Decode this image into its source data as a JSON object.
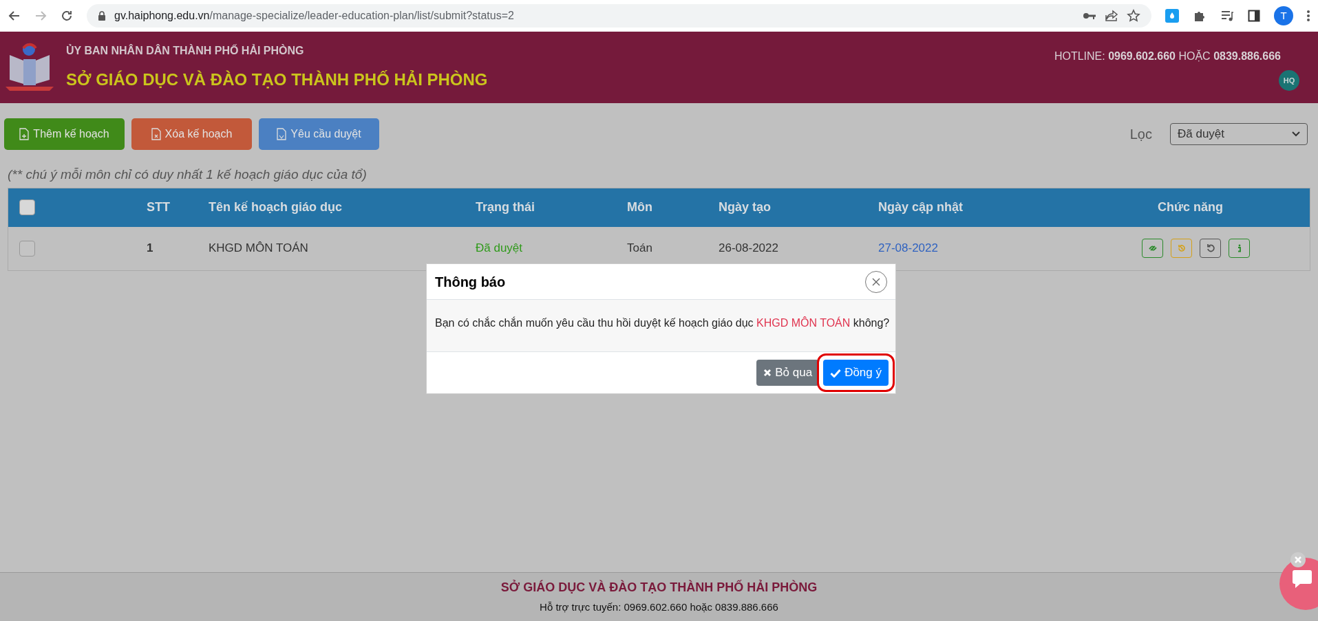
{
  "browser": {
    "url_domain": "gv.haiphong.edu.vn",
    "url_path": "/manage-specialize/leader-education-plan/list/submit?status=2",
    "profile_initial": "T"
  },
  "header": {
    "org": "ỦY BAN NHÂN DÂN THÀNH PHỐ HẢI PHÒNG",
    "title": "SỞ GIÁO DỤC VÀ ĐÀO TẠO THÀNH PHỐ HẢI PHÒNG",
    "hotline": "HOTLINE: **0969.602.660** HOẶC **0839.886.666**",
    "user_badge": "HQ"
  },
  "toolbar": [
    {
      "label": "Thêm kế hoạch",
      "kind": "add"
    },
    {
      "label": "Xóa kế hoạch",
      "kind": "delete"
    },
    {
      "label": "Yêu cầu duyệt",
      "kind": "request"
    }
  ],
  "filter": {
    "label": "Lọc",
    "value": "Đã duyệt"
  },
  "note": "(** chú ý mỗi môn chỉ có duy nhất 1 kế hoạch giáo dục của tổ)",
  "table": {
    "select_all_checked": false,
    "columns": [
      "STT",
      "Tên kế hoạch giáo dục",
      "Trạng thái",
      "Môn",
      "Ngày tạo",
      "Ngày cập nhật",
      "Chức năng"
    ],
    "rows": [
      {
        "checked": false,
        "stt": "1",
        "name": "KHGD MÔN TOÁN",
        "status": "Đã duyệt",
        "subject": "Toán",
        "created": "26-08-2022",
        "updated": "27-08-2022",
        "actions": [
          {
            "kind": "link"
          },
          {
            "kind": "history"
          },
          {
            "kind": "undo"
          },
          {
            "kind": "info"
          }
        ]
      }
    ]
  },
  "dialog": {
    "title": "Thông báo",
    "message": "Bạn có chắc chắn muốn yêu cầu thu hồi duyệt kế hoạch giáo dục",
    "highlight": "KHGD MÔN TOÁN",
    "message_end": "không?",
    "buttons": [
      {
        "label": "Bỏ qua",
        "kind": "cancel",
        "highlighted": false
      },
      {
        "label": "Đồng ý",
        "kind": "confirm",
        "highlighted": true
      }
    ]
  },
  "footer": {
    "title": "SỞ GIÁO DỤC VÀ ĐÀO TẠO THÀNH PHỐ HẢI PHÒNG",
    "support": "Hỗ trợ trực tuyến: 0969.602.660 hoặc 0839.886.666"
  }
}
